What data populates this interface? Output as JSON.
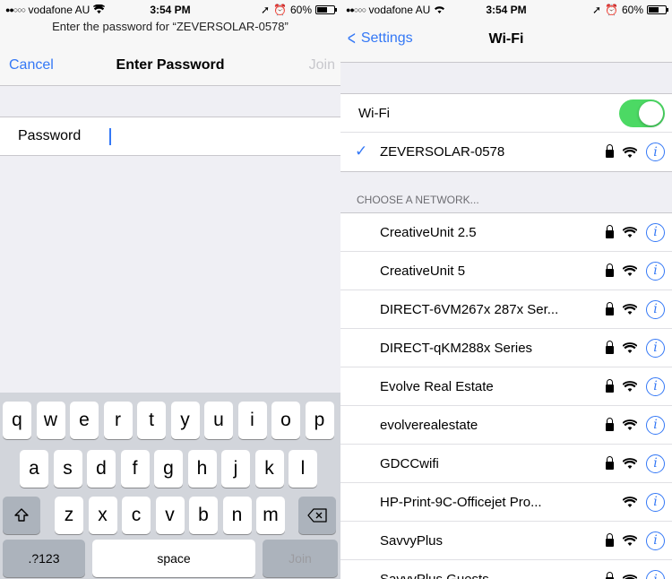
{
  "left": {
    "status": {
      "carrier": "vodafone AU",
      "time": "3:54 PM",
      "battery": "60%",
      "battery_level": 0.6
    },
    "prompt": "Enter the password for “ZEVERSOLAR-0578”",
    "nav": {
      "cancel": "Cancel",
      "title": "Enter Password",
      "join": "Join"
    },
    "password_label": "Password",
    "keyboard": {
      "row1": [
        "q",
        "w",
        "e",
        "r",
        "t",
        "y",
        "u",
        "i",
        "o",
        "p"
      ],
      "row2": [
        "a",
        "s",
        "d",
        "f",
        "g",
        "h",
        "j",
        "k",
        "l"
      ],
      "row3": [
        "z",
        "x",
        "c",
        "v",
        "b",
        "n",
        "m"
      ],
      "numbers_key": ".?123",
      "space_key": "space",
      "join_key": "Join"
    }
  },
  "right": {
    "status": {
      "carrier": "vodafone AU",
      "time": "3:54 PM",
      "battery": "60%",
      "battery_level": 0.6
    },
    "nav": {
      "back": "Settings",
      "title": "Wi-Fi"
    },
    "wifi_label": "Wi-Fi",
    "wifi_on": true,
    "connected": "ZEVERSOLAR-0578",
    "section_header": "CHOOSE A NETWORK...",
    "networks": [
      {
        "name": "CreativeUnit 2.5",
        "locked": true
      },
      {
        "name": "CreativeUnit 5",
        "locked": true
      },
      {
        "name": "DIRECT-6VM267x 287x Ser...",
        "locked": true
      },
      {
        "name": "DIRECT-qKM288x Series",
        "locked": true
      },
      {
        "name": "Evolve Real Estate",
        "locked": true
      },
      {
        "name": "evolverealestate",
        "locked": true
      },
      {
        "name": "GDCCwifi",
        "locked": true
      },
      {
        "name": "HP-Print-9C-Officejet Pro...",
        "locked": false
      },
      {
        "name": "SavvyPlus",
        "locked": true
      },
      {
        "name": "SavvyPlus Guests",
        "locked": true
      }
    ]
  },
  "colors": {
    "accent": "#3478f6",
    "toggle_on": "#4cd964",
    "keyboard_bg": "#d2d5db"
  },
  "icons": [
    "signal-dots-icon",
    "wifi-icon",
    "location-arrow-icon",
    "alarm-icon",
    "battery-icon",
    "lock-icon",
    "info-icon",
    "checkmark-icon",
    "shift-icon",
    "backspace-icon",
    "chevron-left-icon"
  ]
}
